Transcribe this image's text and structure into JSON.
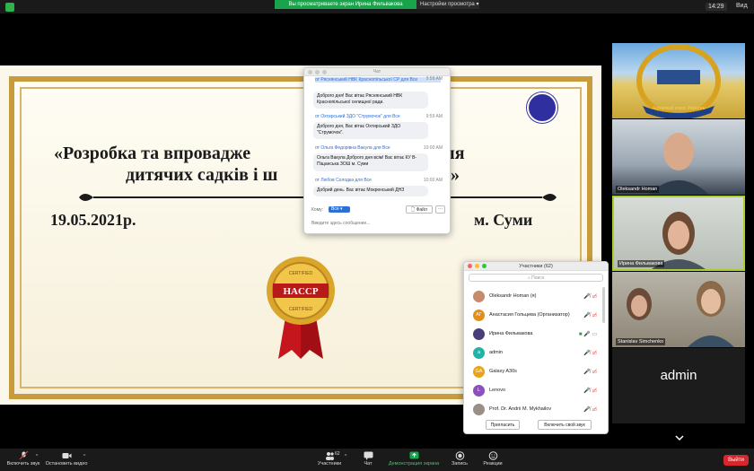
{
  "top_bar": {
    "viewing_text": "Вы просматриваете экран Ирина Фильвакова",
    "view_options": "Настройки просмотра",
    "clock": "14:29",
    "view_label": "Вид"
  },
  "slide": {
    "title_line1": "«Розробка та впровадже",
    "title_line1_right": "АССР) для",
    "title_line2": "дитячих садків і ш",
    "title_line2_right": "ь»",
    "date": "19.05.2021р.",
    "city": "м. Суми",
    "badge_top": "CERTIFIED",
    "badge_center": "HACCP",
    "badge_bottom": "CERTIFIED"
  },
  "chat": {
    "title": "Чат",
    "messages": [
      {
        "from": "от Ряснянський НВК Краснопільської СР для Все",
        "time": "9:58 AM",
        "text": "Доброго дня! Вас вітає Ряснянський НВК Краснопільської селищної ради."
      },
      {
        "from": "от Охтирський ЗДО \"Струмочок\" для Все",
        "time": "9:59 AM",
        "text": "Доброго дня, Вас вітає Охтирський ЗДО \"Струмочок\"."
      },
      {
        "from": "от Ольга Федорівна Вакула для Все",
        "time": "10:00 AM",
        "text": "Ольга Вакула Доброго дня всім! Вас вітає КУ В-Піщанська ЗОШ м. Суми"
      },
      {
        "from": "от Любов Солодка для Все",
        "time": "10:00 AM",
        "text": "Добрий день. Вас вітає Мокренський ДНЗ"
      }
    ],
    "to_label": "Кому:",
    "to_value": "Все",
    "file_button": "Файл",
    "more_button": "···",
    "input_placeholder": "Введите здесь сообщение..."
  },
  "participants": {
    "title": "Участники (62)",
    "search_placeholder": "Поиск",
    "items": [
      {
        "initials": "",
        "name": "Oleksandr Homan (я)",
        "color": "#c58b6a"
      },
      {
        "initials": "АГ",
        "name": "Анастасия Гольцева  (Организатор)",
        "color": "#e38d1a"
      },
      {
        "initials": "",
        "name": "Ирина Фильвакова",
        "color": "#4b3d7a"
      },
      {
        "initials": "a",
        "name": "admin",
        "color": "#22b3a8"
      },
      {
        "initials": "GA",
        "name": "Galaxy A30s",
        "color": "#e8a317"
      },
      {
        "initials": "L",
        "name": "Lenovo",
        "color": "#8e4fc1"
      },
      {
        "initials": "",
        "name": "Prof. Dr. Andrii M. Mykhailov",
        "color": "#9a8f86"
      }
    ],
    "invite_button": "Пригласить",
    "unmute_button": "Включить свой звук"
  },
  "videos": {
    "tile1_logo_text": "Аграрний союз України",
    "tile2_name": "Oleksandr Homan",
    "tile3_name": "Ирина Фильвакова",
    "tile4_name": "Stanislav Simchenko",
    "tile5_name": "admin"
  },
  "toolbar": {
    "unmute": "Включить звук",
    "start_video": "Остановить видео",
    "participants": "Участники",
    "participants_count": "62",
    "chat": "Чат",
    "share_screen": "Демонстрация экрана",
    "record": "Запись",
    "reactions": "Реакции",
    "end": "Выйти"
  },
  "colors": {
    "accent_green": "#19a34a",
    "speaker_border": "#a6d12e",
    "end_red": "#d7262d",
    "link_blue": "#2d6fd6"
  }
}
